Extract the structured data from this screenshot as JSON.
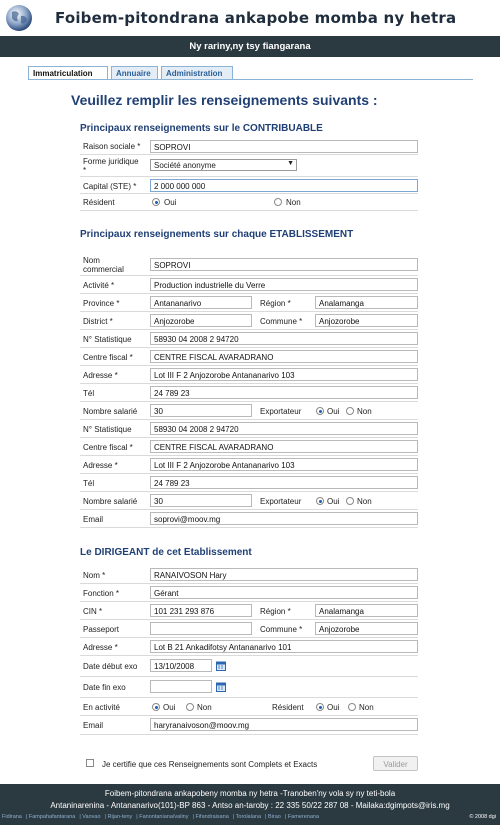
{
  "header": {
    "title": "Foibem-pitondrana ankapobe momba ny hetra"
  },
  "banner": {
    "text": "Ny rariny,ny tsy fiangarana"
  },
  "tabs": [
    "Immatriculation",
    "Annuaire",
    "Administration"
  ],
  "heading": "Veuillez remplir les renseignements suivants :",
  "contribuable": {
    "title": "Principaux renseignements sur le CONTRIBUABLE",
    "raison_label": "Raison sociale *",
    "raison_value": "SOPROVI",
    "forme_label_1": "Forme juridique",
    "forme_label_2": "*",
    "forme_value": "Société anonyme",
    "capital_label": "Capital (STE) *",
    "capital_value": "2 000 000 000",
    "resident_label": "Résident",
    "oui": "Oui",
    "non": "Non"
  },
  "etablissement": {
    "title": "Principaux renseignements sur chaque ETABLISSEMENT",
    "nom_label_1": "Nom",
    "nom_label_2": "commercial",
    "nom_value": "SOPROVI",
    "activite_label": "Activité *",
    "activite_value": "Production industrielle du Verre",
    "province_label": "Province *",
    "province_value": "Antananarivo",
    "region_label": "Région *",
    "region_value": "Analamanga",
    "district_label": "District *",
    "district_value": "Anjozorobe",
    "commune_label": "Commune *",
    "commune_value": "Anjozorobe",
    "blocks": [
      {
        "stat_label": "N° Statistique",
        "stat_value": "58930 04 2008 2 94720",
        "centre_label": "Centre fiscal *",
        "centre_value": "CENTRE FISCAL AVARADRANO",
        "adresse_label": "Adresse *",
        "adresse_value": "Lot III F 2 Anjozorobe Antananarivo 103",
        "tel_label": "Tél",
        "tel_value": "24 789 23",
        "salarie_label": "Nombre salarié",
        "salarie_value": "30",
        "export_label": "Exportateur",
        "oui": "Oui",
        "non": "Non"
      },
      {
        "stat_label": "N° Statistique",
        "stat_value": "58930 04 2008 2 94720",
        "centre_label": "Centre fiscal *",
        "centre_value": "CENTRE FISCAL AVARADRANO",
        "adresse_label": "Adresse *",
        "adresse_value": "Lot III F 2 Anjozorobe Antananarivo 103",
        "tel_label": "Tél",
        "tel_value": "24 789 23",
        "salarie_label": "Nombre salarié",
        "salarie_value": "30",
        "export_label": "Exportateur",
        "oui": "Oui",
        "non": "Non"
      }
    ],
    "email_label": "Email",
    "email_value": "soprovi@moov.mg"
  },
  "dirigeant": {
    "title": "Le DIRIGEANT de cet Etablissement",
    "nom_label": "Nom *",
    "nom_value": "RANAIVOSON Hary",
    "fonction_label": "Fonction *",
    "fonction_value": "Gérant",
    "cin_label": "CIN *",
    "cin_value": "101 231 293 876",
    "region_label": "Région *",
    "region_value": "Analamanga",
    "passeport_label": "Passeport",
    "passeport_value": "",
    "commune_label": "Commune *",
    "commune_value": "Anjozorobe",
    "adresse_label": "Adresse *",
    "adresse_value": "Lot B 21 Ankadifotsy Antananarivo 101",
    "debut_label": "Date début exo",
    "debut_value": "13/10/2008",
    "fin_label": "Date fin exo",
    "fin_value": "",
    "activite_label": "En activité",
    "resident_label": "Résident",
    "oui": "Oui",
    "non": "Non",
    "email_label": "Email",
    "email_value": "haryranaivoson@moov.mg"
  },
  "certify": "Je certifie que ces Renseignements sont Complets et Exacts",
  "submit": "Valider",
  "footer": {
    "line1": "Foibem-pitondrana ankapobeny momba ny hetra -Tranoben'ny vola sy ny teti-bola",
    "line2": "Antaninarenina - Antananarivo(101)-BP 863 - Antso an-taroby : 22 335 50/22 287 08 - Mailaka:dgimpots@iris.mg",
    "links": [
      "Fidirana",
      "Fampahafantarana",
      "Vaovao",
      "Rijan-teny",
      "Fanontaniana/valiny",
      "Fifandraisana",
      "Torolalana",
      "Birao",
      "Famerenana"
    ],
    "copyright": "© 2008 dgi"
  },
  "colors": {
    "dark_bar": "#2b3940",
    "heading_blue": "#1f3f75",
    "tab_border": "#8ab3d6"
  }
}
